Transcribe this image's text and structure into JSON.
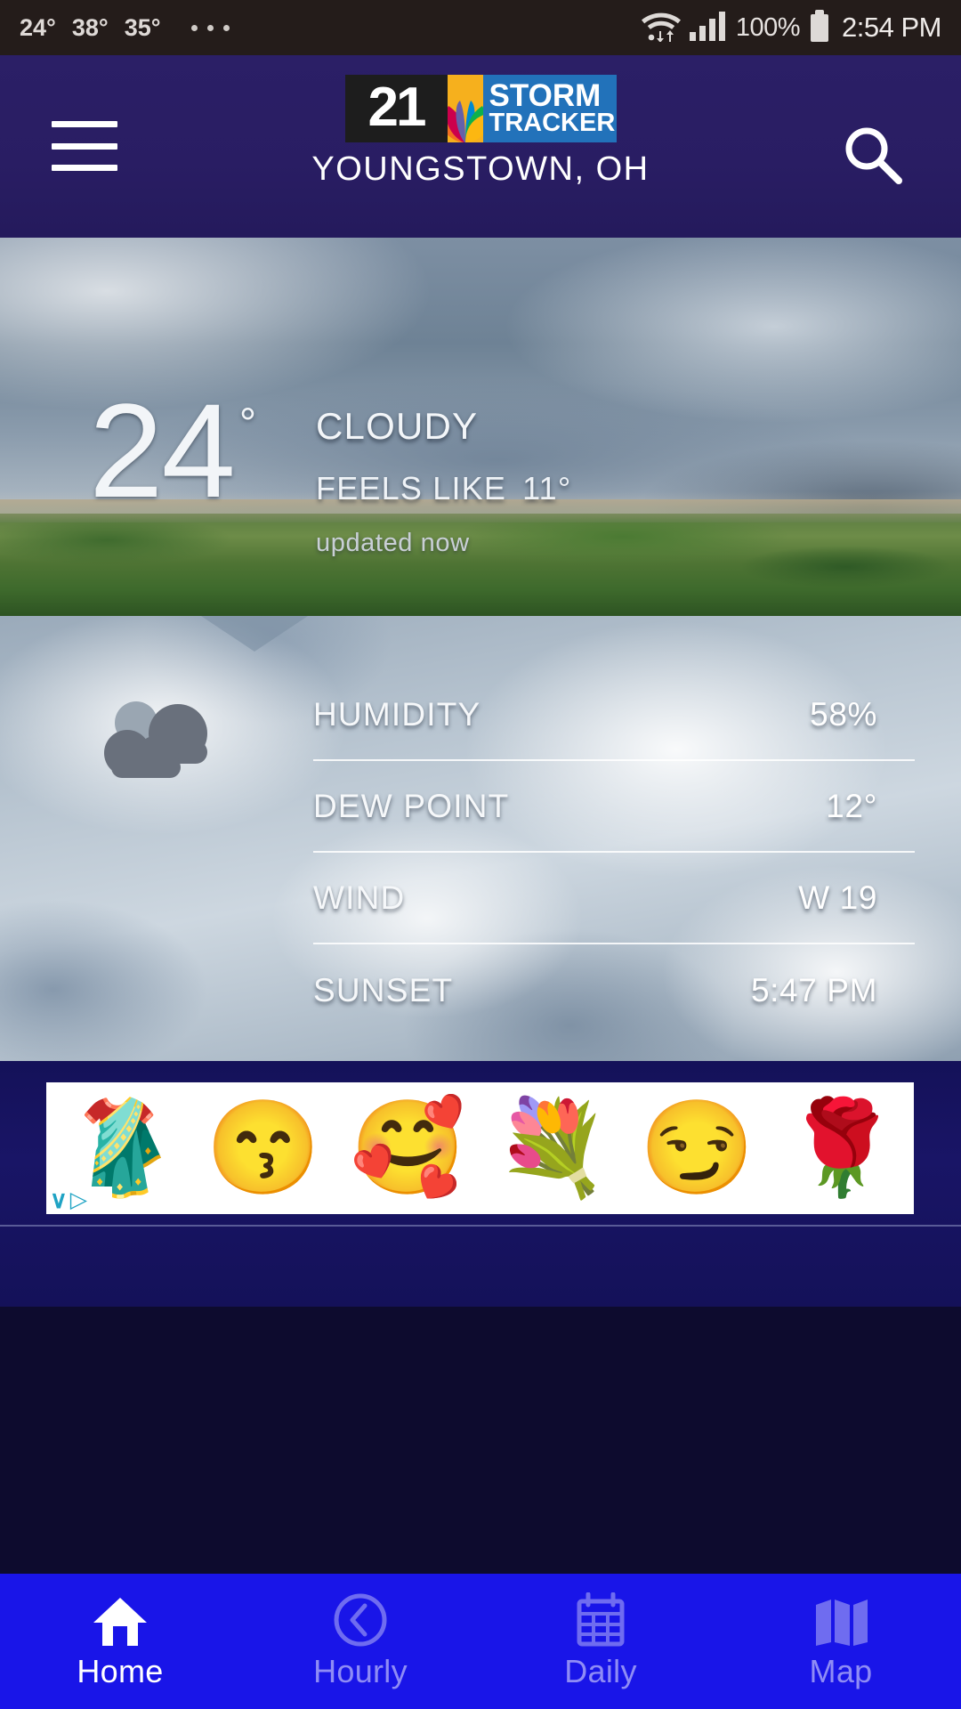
{
  "statusbar": {
    "temps": [
      "24°",
      "38°",
      "35°"
    ],
    "overflow_icon": "more-dots-icon",
    "wifi_icon": "wifi-icon",
    "signal_icon": "cellular-signal-icon",
    "battery_percent": "100%",
    "battery_icon": "battery-full-icon",
    "time": "2:54 PM"
  },
  "header": {
    "menu_icon": "hamburger-menu-icon",
    "search_icon": "search-icon",
    "logo": {
      "channel": "21",
      "peacock_icon": "nbc-peacock-icon",
      "line1": "STORM",
      "line2": "TRACKER"
    },
    "city": "YOUNGSTOWN, OH",
    "bg_color": "#2b1f66",
    "logo_black": "#1d1d1d",
    "logo_yellow": "#f6b01d",
    "logo_blue": "#2272ba"
  },
  "current": {
    "temperature": "24",
    "degree": "°",
    "condition": "CLOUDY",
    "feels_like_label": "FEELS LIKE",
    "feels_like_value": "11°",
    "updated": "updated now"
  },
  "details": {
    "condition_icon": "cloudy-icon",
    "rows": [
      {
        "label": "HUMIDITY",
        "value": "58%"
      },
      {
        "label": "DEW POINT",
        "value": "12°"
      },
      {
        "label": "WIND",
        "value": "W 19"
      },
      {
        "label": "SUNSET",
        "value": "5:47 PM"
      }
    ]
  },
  "ad": {
    "emojis": [
      "🥻",
      "😙",
      "🥰",
      "💐",
      "😏",
      "🌹"
    ],
    "adchoices_chevron": "∨",
    "adchoices_triangle": "▷",
    "adchoices_icon": "adchoices-icon"
  },
  "bottom_nav": {
    "accent_color": "#1915e8",
    "active_color": "#ffffff",
    "inactive_color": "#8f8cf5",
    "items": [
      {
        "label": "Home",
        "icon": "home-icon",
        "active": true
      },
      {
        "label": "Hourly",
        "icon": "clock-icon",
        "active": false
      },
      {
        "label": "Daily",
        "icon": "calendar-icon",
        "active": false
      },
      {
        "label": "Map",
        "icon": "map-icon",
        "active": false
      }
    ]
  }
}
